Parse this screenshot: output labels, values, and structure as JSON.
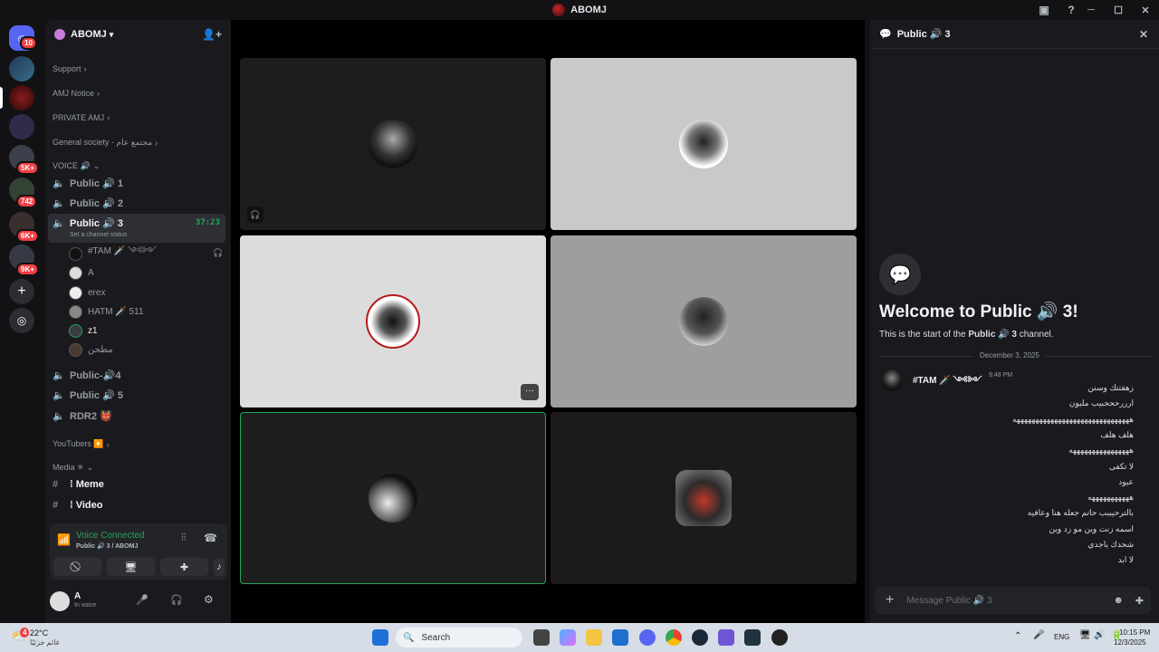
{
  "window": {
    "title": "ABOMJ"
  },
  "rail": {
    "badges": [
      "10",
      "5K+",
      "742",
      "6K+",
      "9K+"
    ]
  },
  "server": {
    "name": "ABOMJ"
  },
  "categories": {
    "support": "Support",
    "notice": "AMJ Notice",
    "private": "PRIVATE AMJ",
    "general": "General society - مجتمع عام",
    "voice": "VOICE 🔊",
    "youtubers": "YouTubers ▶️",
    "media": "Media ✳"
  },
  "channels": [
    {
      "name": "Public 🔊 1"
    },
    {
      "name": "Public 🔊 2"
    },
    {
      "name": "Public 🔊 3",
      "timer": "37:23",
      "status": "Set a channel status"
    },
    {
      "name": "Public-🔊4"
    },
    {
      "name": "Public 🔊 5"
    },
    {
      "name": "RDR2 👹"
    }
  ],
  "voice_users": [
    {
      "name": "#TAM 🗡️ ༺༻"
    },
    {
      "name": "A"
    },
    {
      "name": "erex"
    },
    {
      "name": "HATM 🗡️ 511"
    },
    {
      "name": "z1"
    },
    {
      "name": "مطحن"
    }
  ],
  "text_channels": [
    {
      "name": "⁞ Meme"
    },
    {
      "name": "⁞ Video"
    }
  ],
  "voice_panel": {
    "status": "Voice Connected",
    "location": "Public 🔊 3 / ABOMJ"
  },
  "user_panel": {
    "name": "A",
    "status": "In voice"
  },
  "chat": {
    "header": "Public 🔊 3",
    "welcome_title": "Welcome to Public 🔊 3!",
    "welcome_pre": "This is the start of the ",
    "welcome_channel": "Public 🔊 3",
    "welcome_post": " channel.",
    "date_divider": "December 3, 2025",
    "author": "#TAM 🗡️ ༺༻",
    "time": "9:48 PM",
    "lines": [
      "زهقتتك وسنن",
      "ارررحححبيب مليون",
      "هههههههههههههههههههههههههههههههه",
      "هلف هلف",
      "ههههههههههههههههه",
      "لا تكفى",
      "عيود",
      "هههههههههههه",
      "بالترحيببب حاتم جعله هنا وعافيه",
      "اسمه زنت وين مو زد وين",
      "شحدك ياجدي",
      "لا ابد"
    ],
    "placeholder": "Message Public 🔊 3"
  },
  "taskbar": {
    "weather_temp": "22°C",
    "weather_desc": "غائم جزئيًا",
    "weather_badge": "4",
    "search_label": "Search",
    "lang": "ENG",
    "time": "10:15 PM",
    "date": "12/3/2025"
  },
  "colors": {
    "accent_green": "#23a55a",
    "badge_red": "#f23f43"
  }
}
